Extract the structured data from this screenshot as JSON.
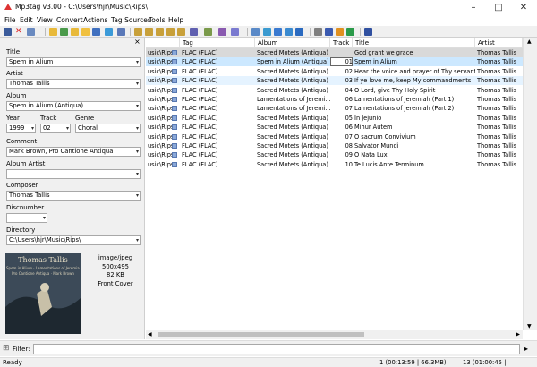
{
  "window": {
    "title": "Mp3tag v3.00  -  C:\\Users\\hjr\\Music\\Rips\\"
  },
  "menu": [
    "File",
    "Edit",
    "View",
    "Convert",
    "Actions",
    "Tag Sources",
    "Tools",
    "Help"
  ],
  "fields": {
    "title": {
      "label": "Title",
      "value": "Spem in Alium"
    },
    "artist": {
      "label": "Artist",
      "value": "Thomas Tallis"
    },
    "album": {
      "label": "Album",
      "value": "Spem in Alium (Antiqua)"
    },
    "year": {
      "label": "Year",
      "value": "1999"
    },
    "track": {
      "label": "Track",
      "value": "02"
    },
    "genre": {
      "label": "Genre",
      "value": "Choral"
    },
    "comment": {
      "label": "Comment",
      "value": "Mark Brown, Pro Cantione Antiqua"
    },
    "album_artist": {
      "label": "Album Artist",
      "value": ""
    },
    "composer": {
      "label": "Composer",
      "value": "Thomas Tallis"
    },
    "discnumber": {
      "label": "Discnumber",
      "value": ""
    },
    "directory": {
      "label": "Directory",
      "value": "C:\\Users\\hjr\\Music\\Rips\\"
    }
  },
  "cover": {
    "text_line1": "Thomas Tallis",
    "text_line2": "Spem in Alium · Lamentations of Jeremiah",
    "text_line3": "Pro Cantione Antiqua · Mark Brown",
    "mime": "image/jpeg",
    "dims": "500x495",
    "size": "82 KB",
    "type": "Front Cover"
  },
  "table": {
    "columns": [
      "",
      "Tag",
      "Album",
      "Track",
      "Title",
      "Artist"
    ],
    "rows": [
      {
        "path": "usic\\Rips\\",
        "tag": "FLAC (FLAC)",
        "album": "Sacred Motets (Antiqua)",
        "track": "",
        "title": "God grant we grace",
        "artist": "Thomas Tallis",
        "state": "sel2"
      },
      {
        "path": "usic\\Rips\\",
        "tag": "FLAC (FLAC)",
        "album": "Spem in Alium (Antiqua)",
        "track": "01",
        "title": "Spem in Alium",
        "artist": "Thomas Tallis",
        "state": "sel"
      },
      {
        "path": "usic\\Rips\\",
        "tag": "FLAC (FLAC)",
        "album": "Sacred Motets (Antiqua)",
        "track": "02",
        "title": "Hear the voice and prayer of Thy servant",
        "artist": "Thomas Tallis",
        "state": ""
      },
      {
        "path": "usic\\Rips\\",
        "tag": "FLAC (FLAC)",
        "album": "Sacred Motets (Antiqua)",
        "track": "03",
        "title": "If ye love me, keep My commandments",
        "artist": "Thomas Tallis",
        "state": "hl"
      },
      {
        "path": "usic\\Rips\\",
        "tag": "FLAC (FLAC)",
        "album": "Sacred Motets (Antiqua)",
        "track": "04",
        "title": "O Lord, give Thy Holy Spirit",
        "artist": "Thomas Tallis",
        "state": ""
      },
      {
        "path": "usic\\Rips\\",
        "tag": "FLAC (FLAC)",
        "album": "Lamentations of Jeremi...",
        "track": "06",
        "title": "Lamentations of Jeremiah (Part 1)",
        "artist": "Thomas Tallis",
        "state": ""
      },
      {
        "path": "usic\\Rips\\",
        "tag": "FLAC (FLAC)",
        "album": "Lamentations of Jeremi...",
        "track": "07",
        "title": "Lamentations of Jeremiah (Part 2)",
        "artist": "Thomas Tallis",
        "state": ""
      },
      {
        "path": "usic\\Rips\\",
        "tag": "FLAC (FLAC)",
        "album": "Sacred Motets (Antiqua)",
        "track": "05",
        "title": "In Jejunio",
        "artist": "Thomas Tallis",
        "state": ""
      },
      {
        "path": "usic\\Rips\\",
        "tag": "FLAC (FLAC)",
        "album": "Sacred Motets (Antiqua)",
        "track": "06",
        "title": "Mihur Autem",
        "artist": "Thomas Tallis",
        "state": ""
      },
      {
        "path": "usic\\Rips\\",
        "tag": "FLAC (FLAC)",
        "album": "Sacred Motets (Antiqua)",
        "track": "07",
        "title": "O sacrum Convivium",
        "artist": "Thomas Tallis",
        "state": ""
      },
      {
        "path": "usic\\Rips\\",
        "tag": "FLAC (FLAC)",
        "album": "Sacred Motets (Antiqua)",
        "track": "08",
        "title": "Salvator Mundi",
        "artist": "Thomas Tallis",
        "state": ""
      },
      {
        "path": "usic\\Rips\\",
        "tag": "FLAC (FLAC)",
        "album": "Sacred Motets (Antiqua)",
        "track": "09",
        "title": "O Nata Lux",
        "artist": "Thomas Tallis",
        "state": ""
      },
      {
        "path": "usic\\Rips\\",
        "tag": "FLAC (FLAC)",
        "album": "Sacred Motets (Antiqua)",
        "track": "10",
        "title": "Te Lucis Ante Terminum",
        "artist": "Thomas Tallis",
        "state": ""
      }
    ]
  },
  "filter": {
    "label": "Filter:",
    "value": ""
  },
  "status": {
    "left": "Ready",
    "mid": "1 (00:13:59 | 66.3MB)",
    "right": "13 (01:00:45 | 256.2MB)"
  },
  "colors": {
    "accent": "#cce8ff",
    "panel": "#f0f0f0"
  }
}
